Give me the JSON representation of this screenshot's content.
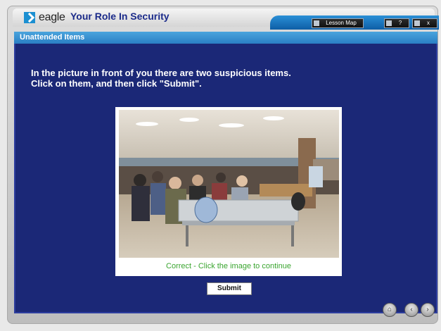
{
  "app": {
    "brand": "eagle",
    "course_title": "Your Role In Security"
  },
  "top_controls": {
    "lesson_map_label": "Lesson Map",
    "help_label": "?",
    "close_label": "x"
  },
  "lesson": {
    "section_title": "Unattended Items",
    "instruction_line1": "In the picture in front of you  there are two suspicious items.",
    "instruction_line2": "Click on them, and then click \"Submit\".",
    "feedback": "Correct - Click the image to continue",
    "submit_label": "Submit"
  },
  "bottom_nav": {
    "home_icon": "home-icon",
    "prev_icon": "previous-icon",
    "next_icon": "next-icon"
  },
  "colors": {
    "content_bg": "#1b2877",
    "header_bg": "#2a7fc4",
    "feedback_text": "#3aa52f",
    "title_text": "#1b2b8a",
    "accent_blue": "#1b8fd1"
  }
}
